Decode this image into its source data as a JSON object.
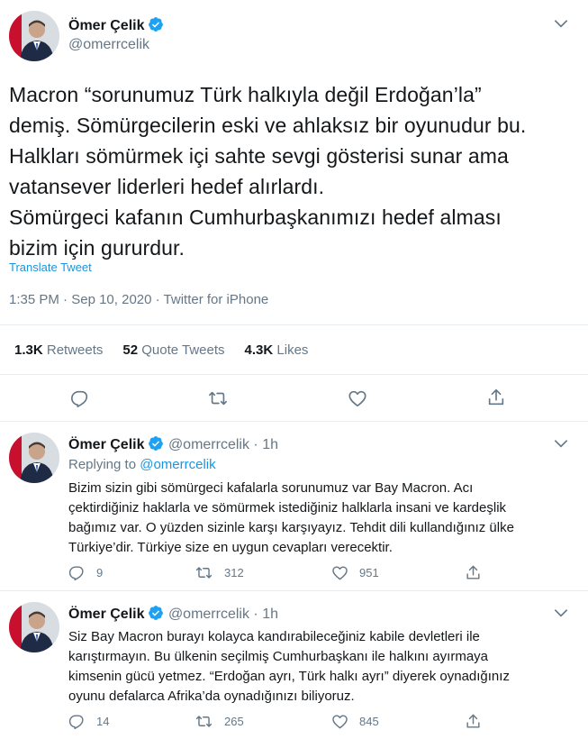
{
  "colors": {
    "accent": "#1da1f2",
    "link": "#1b95e0",
    "muted": "#657786",
    "text": "#14171a",
    "divider": "#e6ecf0"
  },
  "main_tweet": {
    "author_name": "Ömer Çelik",
    "author_handle": "@omerrcelik",
    "verified": true,
    "text_lines": [
      "Macron “sorunumuz Türk halkıyla değil Erdoğan’la”",
      "demiş.  Sömürgecilerin eski ve ahlaksız bir oyunudur bu.",
      "Halkları sömürmek içi sahte sevgi gösterisi sunar  ama",
      "vatansever liderleri hedef alırlardı.",
      "Sömürgeci kafanın Cumhurbaşkanımızı hedef alması",
      "bizim için gururdur."
    ],
    "translate_label": "Translate Tweet",
    "time": "1:35 PM",
    "date": "Sep 10, 2020",
    "source": "Twitter for iPhone",
    "meta_sep": "·",
    "stats": {
      "retweets_count": "1.3K",
      "retweets_label": "Retweets",
      "quote_count": "52",
      "quote_label": "Quote Tweets",
      "likes_count": "4.3K",
      "likes_label": "Likes"
    },
    "icons": [
      "reply-icon",
      "retweet-icon",
      "like-icon",
      "share-icon"
    ]
  },
  "replies": [
    {
      "author_name": "Ömer Çelik",
      "author_handle": "@omerrcelik",
      "sep": "·",
      "age": "1h",
      "replying_prefix": "Replying to",
      "replying_to": "@omerrcelik",
      "text_lines": [
        "Bizim sizin gibi sömürgeci kafalarla sorunumuz var Bay Macron. Acı",
        "çektirdiğiniz haklarla ve sömürmek istediğiniz halklarla insani ve kardeşlik",
        "bağımız var. O yüzden sizinle karşı karşıyayız. Tehdit dili kullandığınız ülke",
        "Türkiye’dir. Türkiye size en uygun cevapları verecektir."
      ],
      "reply_count": "9",
      "retweet_count": "312",
      "like_count": "951"
    },
    {
      "author_name": "Ömer Çelik",
      "author_handle": "@omerrcelik",
      "sep": "·",
      "age": "1h",
      "text_lines": [
        "Siz Bay Macron burayı kolayca kandırabileceğiniz kabile devletleri ile",
        "karıştırmayın. Bu ülkenin seçilmiş Cumhurbaşkanı ile halkını ayırmaya",
        "kimsenin gücü yetmez. “Erdoğan ayrı, Türk halkı ayrı” diyerek oynadığınız",
        "oyunu defalarca Afrika’da oynadığınızı biliyoruz."
      ],
      "reply_count": "14",
      "retweet_count": "265",
      "like_count": "845"
    }
  ]
}
